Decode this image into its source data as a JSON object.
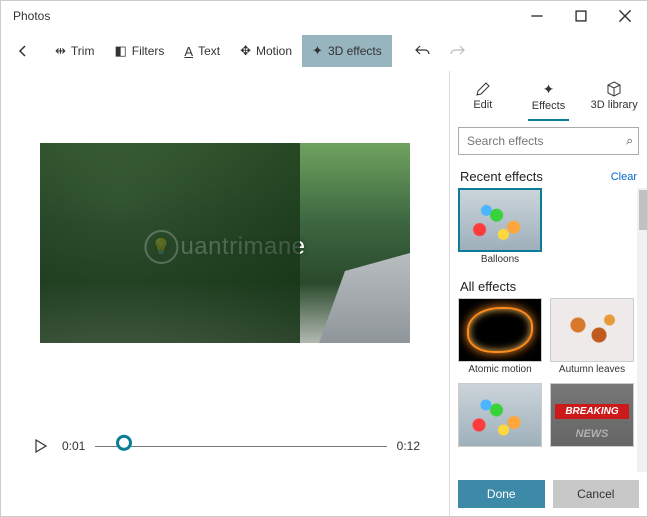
{
  "window": {
    "title": "Photos"
  },
  "toolbar": {
    "back": "←",
    "items": [
      {
        "label": "Trim"
      },
      {
        "label": "Filters"
      },
      {
        "label": "Text"
      },
      {
        "label": "Motion"
      },
      {
        "label": "3D effects",
        "active": true
      }
    ]
  },
  "player": {
    "current_time": "0:01",
    "duration": "0:12",
    "progress_percent": 10
  },
  "watermark": "uantrimane",
  "panel": {
    "tabs": {
      "edit": "Edit",
      "effects": "Effects",
      "library": "3D library"
    },
    "search_placeholder": "Search effects",
    "recent": {
      "heading": "Recent effects",
      "clear": "Clear",
      "items": [
        {
          "label": "Balloons",
          "selected": true
        }
      ]
    },
    "all": {
      "heading": "All effects",
      "items": [
        {
          "label": "Atomic motion"
        },
        {
          "label": "Autumn leaves"
        },
        {
          "label": ""
        },
        {
          "label": ""
        }
      ]
    },
    "footer": {
      "done": "Done",
      "cancel": "Cancel"
    }
  }
}
